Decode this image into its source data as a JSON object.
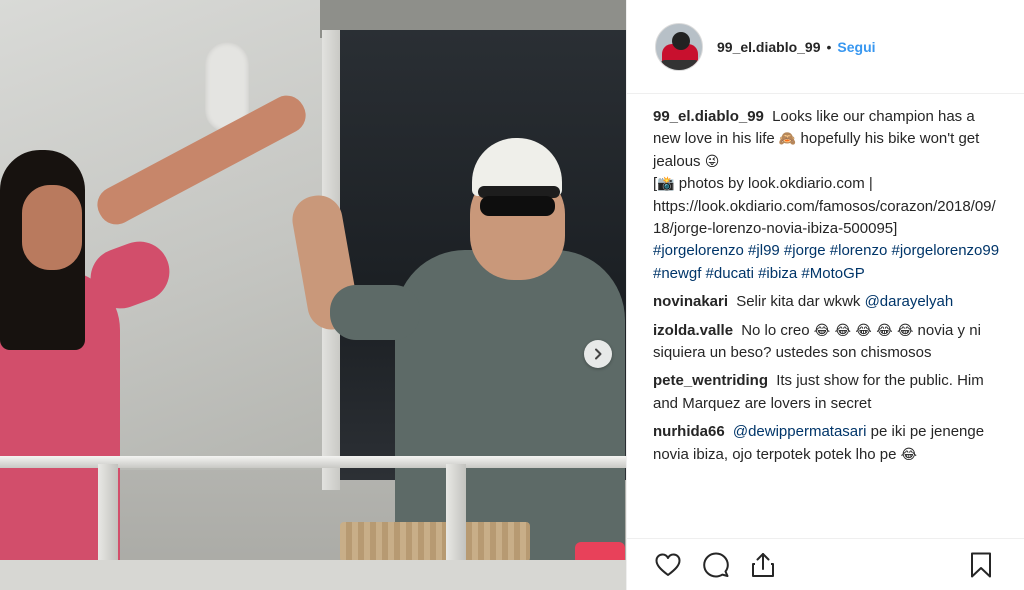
{
  "post": {
    "username": "99_el.diablo_99",
    "follow_label": "Segui",
    "separator": "•",
    "caption": {
      "user": "99_el.diablo_99",
      "line1": "Looks like our champion has a new love in his life",
      "emoji1": "🙈",
      "line2": "hopefully his bike won't get jealous",
      "emoji2": "😜",
      "credit_open": "[",
      "camera_emoji": "📸",
      "credit": "photos by look.okdiario.com | https://look.okdiario.com/famosos/corazon/2018/09/18/jorge-lorenzo-novia-ibiza-500095]",
      "hashtags": "#jorgelorenzo #jl99 #jorge #lorenzo #jorgelorenzo99 #newgf #ducati #ibiza #MotoGP"
    }
  },
  "comments": [
    {
      "user": "novinakari",
      "text": "Selir kita dar wkwk",
      "mention": "@darayelyah"
    },
    {
      "user": "izolda.valle",
      "text_before": "No lo creo",
      "emojis": "😂 😂 😂 😂 😂",
      "text_after": "novia y ni siquiera un beso? ustedes son chismosos"
    },
    {
      "user": "pete_wentriding",
      "text": "Its just show for the public. Him and Marquez are lovers in secret"
    },
    {
      "user": "nurhida66",
      "mention": "@dewippermatasari",
      "text": "pe iki pe jenenge novia ibiza, ojo terpotek potek lho pe",
      "emoji": "😂"
    }
  ],
  "icons": {
    "next": "chevron-right-icon",
    "like": "heart-icon",
    "comment": "comment-bubble-icon",
    "share": "share-icon",
    "save": "bookmark-icon"
  },
  "colors": {
    "link_blue": "#3897f0",
    "hashtag_blue": "#003569",
    "text": "#262626"
  }
}
